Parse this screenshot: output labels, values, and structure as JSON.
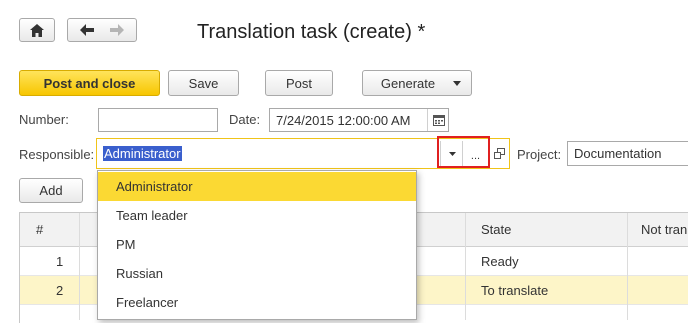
{
  "nav": {},
  "window": {
    "title": "Translation task (create) *"
  },
  "toolbar": {
    "post_and_close": "Post and close",
    "save": "Save",
    "post": "Post",
    "generate": "Generate"
  },
  "form": {
    "number_label": "Number:",
    "number_value": "",
    "date_label": "Date:",
    "date_value": "7/24/2015 12:00:00 AM",
    "responsible_label": "Responsible:",
    "responsible_value": "Administrator",
    "project_label": "Project:",
    "project_value": "Documentation",
    "select_more": "..."
  },
  "table": {
    "add_label": "Add",
    "columns": [
      "#",
      "State",
      "Not tran"
    ],
    "rows": [
      {
        "num": "1",
        "state": "Ready"
      },
      {
        "num": "2",
        "state": "To translate"
      }
    ]
  },
  "dropdown": {
    "options": [
      "Administrator",
      "Team leader",
      "PM",
      "Russian",
      "Freelancer"
    ],
    "selected": "Administrator"
  },
  "colors": {
    "accent": "#fbd933",
    "row_highlight": "#fdf5c8",
    "focus_border": "#f0c419",
    "callout": "#e02020"
  }
}
